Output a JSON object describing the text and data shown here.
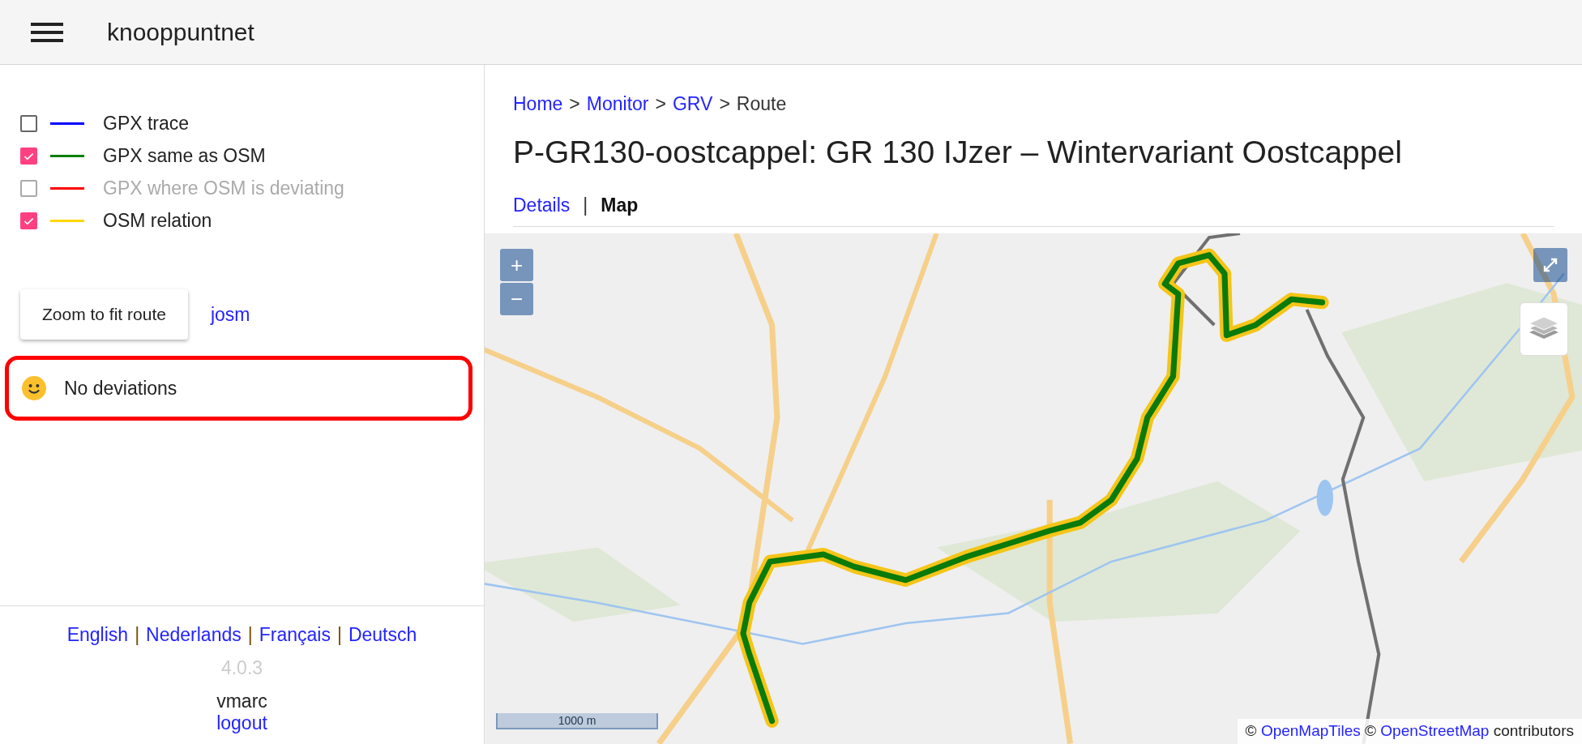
{
  "header": {
    "title": "knooppuntnet"
  },
  "legend": [
    {
      "label": "GPX trace",
      "checked": false,
      "disabled": false,
      "color": "#0000ff"
    },
    {
      "label": "GPX same as OSM",
      "checked": true,
      "disabled": false,
      "color": "#008000"
    },
    {
      "label": "GPX where OSM is deviating",
      "checked": false,
      "disabled": true,
      "color": "#ff0000"
    },
    {
      "label": "OSM relation",
      "checked": true,
      "disabled": false,
      "color": "#ffd700"
    }
  ],
  "actions": {
    "zoom_button": "Zoom to fit route",
    "josm_link": "josm"
  },
  "status": {
    "text": "No deviations",
    "highlighted": true
  },
  "languages": {
    "separator": "|",
    "items": [
      "English",
      "Nederlands",
      "Français",
      "Deutsch"
    ]
  },
  "version": "4.0.3",
  "user": "vmarc",
  "logout": "logout",
  "breadcrumb": {
    "separator": ">",
    "items": [
      {
        "label": "Home",
        "link": true
      },
      {
        "label": "Monitor",
        "link": true
      },
      {
        "label": "GRV",
        "link": true
      },
      {
        "label": "Route",
        "link": false
      }
    ]
  },
  "title": "P-GR130-oostcappel: GR 130 IJzer – Wintervariant Oostcappel",
  "tabs": {
    "separator": "|",
    "items": [
      {
        "label": "Details",
        "selected": false
      },
      {
        "label": "Map",
        "selected": true
      }
    ]
  },
  "map": {
    "kind": "picture",
    "zoom_in": "+",
    "zoom_out": "−",
    "scale": "1000 m",
    "attribution": [
      {
        "kind": "text",
        "text": "©"
      },
      {
        "kind": "link",
        "text": "OpenMapTiles"
      },
      {
        "kind": "text",
        "text": "©"
      },
      {
        "kind": "link",
        "text": "OpenStreetMap"
      },
      {
        "kind": "text",
        "text": "contributors"
      }
    ]
  }
}
